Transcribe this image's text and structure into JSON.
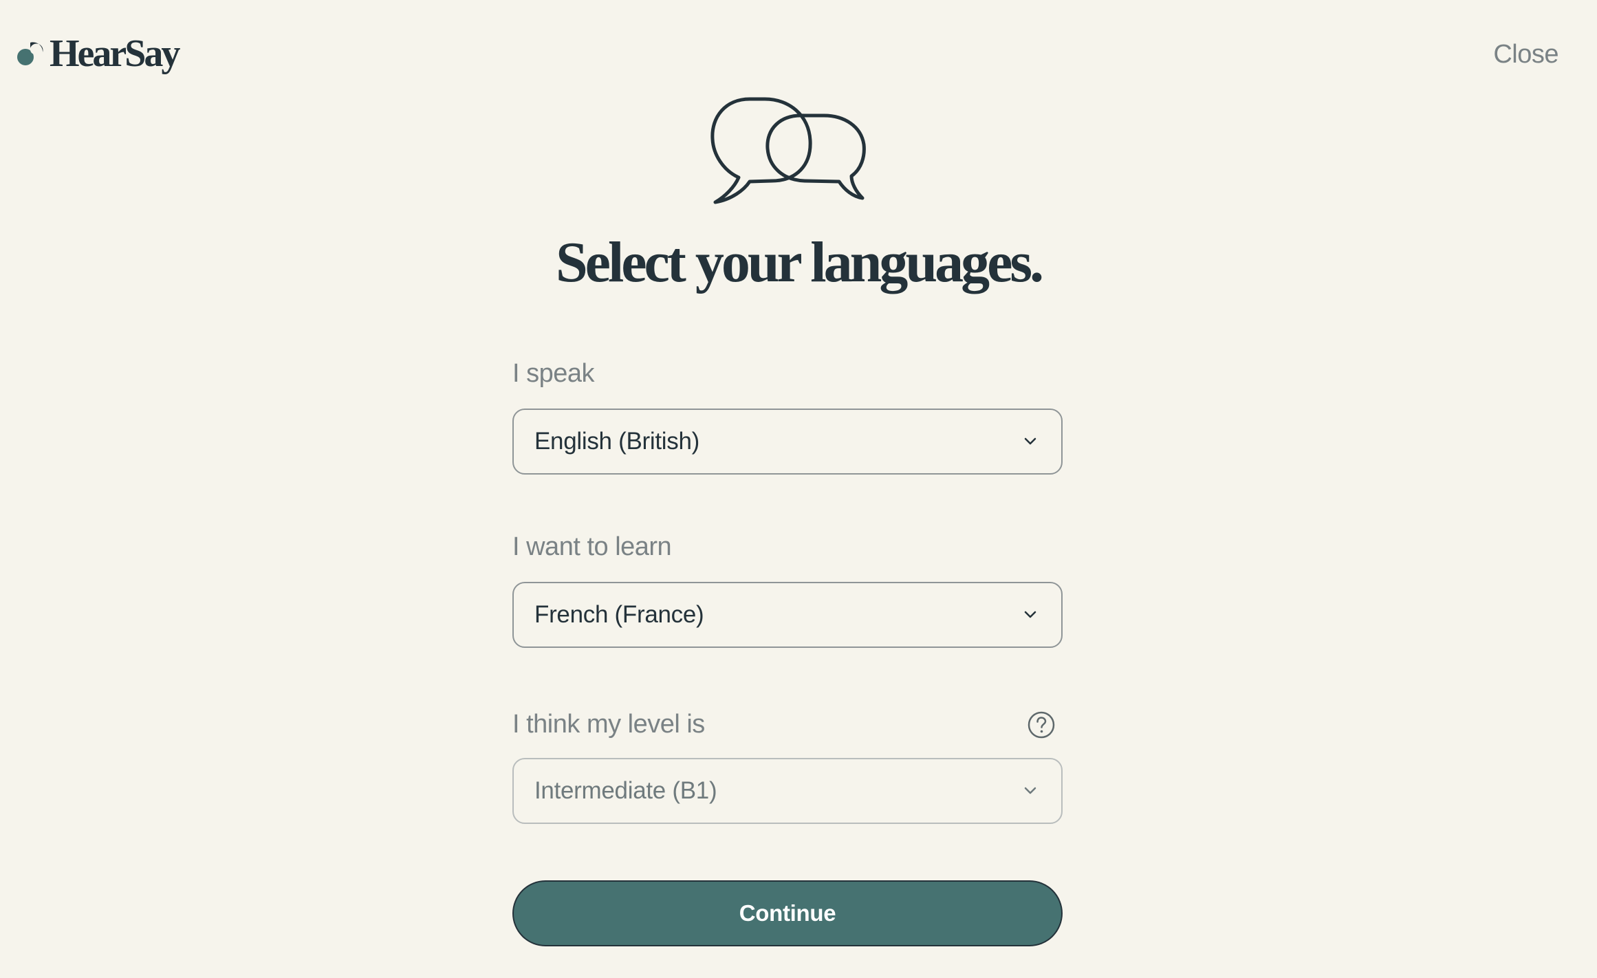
{
  "header": {
    "brand": "HearSay",
    "close_label": "Close"
  },
  "main": {
    "title": "Select your languages."
  },
  "form": {
    "speak": {
      "label": "I speak",
      "value": "English (British)"
    },
    "learn": {
      "label": "I want to learn",
      "value": "French (France)"
    },
    "level": {
      "label": "I think my level is",
      "value": "Intermediate (B1)"
    },
    "continue_label": "Continue"
  },
  "colors": {
    "background": "#f6f4ec",
    "text": "#24323a",
    "muted_text": "#7a8285",
    "accent": "#467271",
    "logo_mark": "#467271"
  },
  "icons": {
    "logo": "hearsay-logo-mark",
    "hero": "speech-bubbles-icon",
    "dropdown": "chevron-down-icon",
    "help": "question-circle-icon"
  }
}
